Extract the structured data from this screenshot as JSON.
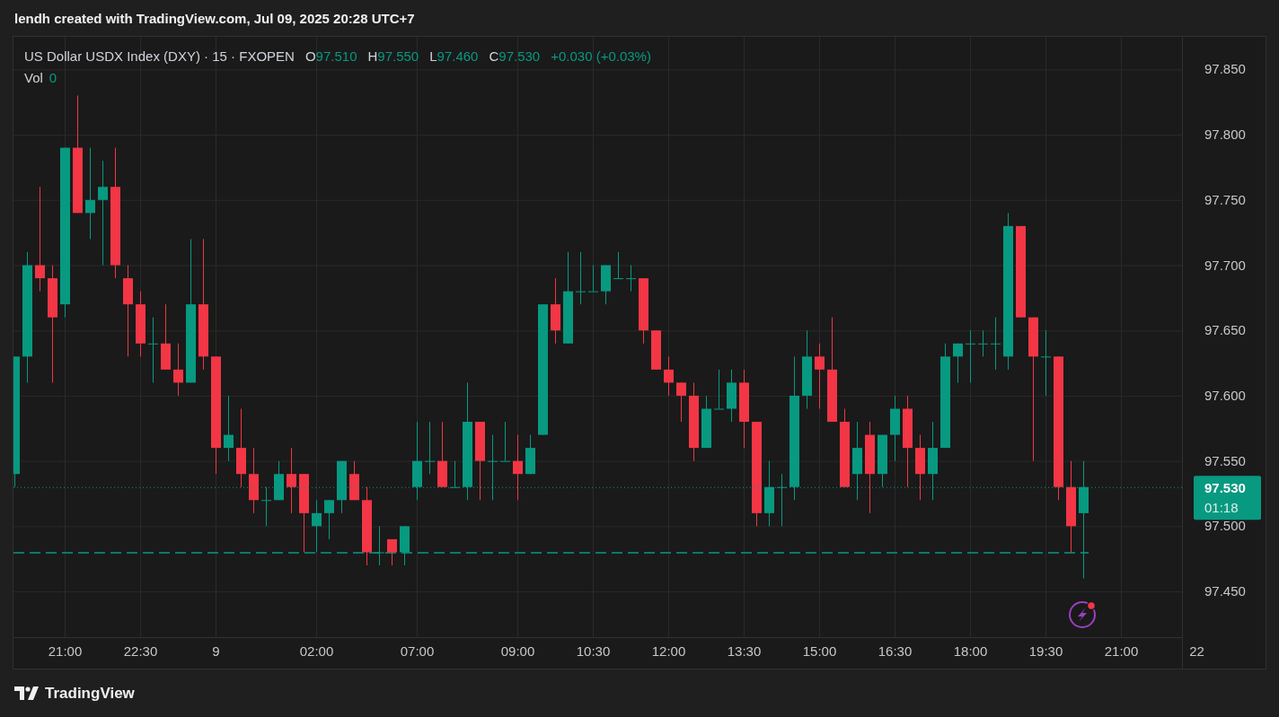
{
  "header": {
    "text": "lendh created with TradingView.com, Jul 09, 2025 20:28 UTC+7"
  },
  "legend": {
    "symbol": "US Dollar USDX Index (DXY) · 15 · FXOPEN",
    "ohlc": [
      {
        "label": "O",
        "value": "97.510"
      },
      {
        "label": "H",
        "value": "97.550"
      },
      {
        "label": "L",
        "value": "97.460"
      },
      {
        "label": "C",
        "value": "97.530"
      }
    ],
    "change": "+0.030 (+0.03%)",
    "volume": {
      "label": "Vol",
      "value": "0"
    }
  },
  "price_axis": {
    "labels": [
      "97.850",
      "97.800",
      "97.750",
      "97.700",
      "97.650",
      "97.600",
      "97.550",
      "97.500",
      "97.450"
    ]
  },
  "time_axis": {
    "labels": [
      "21:00",
      "22:30",
      "9",
      "02:00",
      "07:00",
      "09:00",
      "10:30",
      "12:00",
      "13:30",
      "15:00",
      "16:30",
      "18:00",
      "19:30",
      "21:00",
      "22"
    ]
  },
  "price_tag": {
    "price": "97.530",
    "countdown": "01:18"
  },
  "footer": {
    "logo_text": "TradingView"
  }
}
